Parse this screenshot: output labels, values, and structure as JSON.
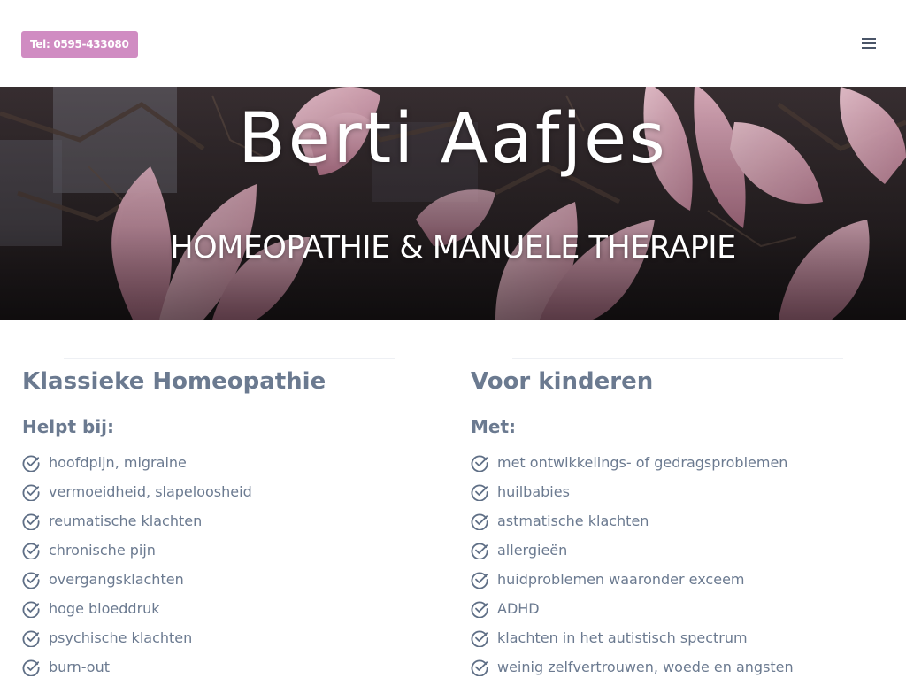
{
  "header": {
    "tel_label": "Tel: 0595-433080",
    "menu_icon": "hamburger-menu-icon",
    "tel_button_color": "#d08cc2"
  },
  "hero": {
    "title": "Berti Aafjes",
    "subtitle": "HOMEOPATHIE & MANUELE THERAPIE"
  },
  "colors": {
    "heading": "#6b7a90",
    "text": "#6b7a90",
    "divider": "#eef0f4"
  },
  "columns": [
    {
      "title": "Klassieke Homeopathie",
      "subtitle": "Helpt bij:",
      "items": [
        "hoofdpijn, migraine",
        "vermoeidheid, slapeloosheid",
        "reumatische klachten",
        "chronische pijn",
        "overgangsklachten",
        "hoge bloeddruk",
        "psychische klachten",
        "burn-out"
      ]
    },
    {
      "title": "Voor kinderen",
      "subtitle": "Met:",
      "items": [
        "met ontwikkelings- of gedragsproblemen",
        "huilbabies",
        "astmatische klachten",
        "allergieën",
        "huidproblemen waaronder exceem",
        "ADHD",
        "klachten in het autistisch spectrum",
        "weinig zelfvertrouwen, woede en angsten"
      ]
    }
  ],
  "list_icon": "check-circle-icon"
}
